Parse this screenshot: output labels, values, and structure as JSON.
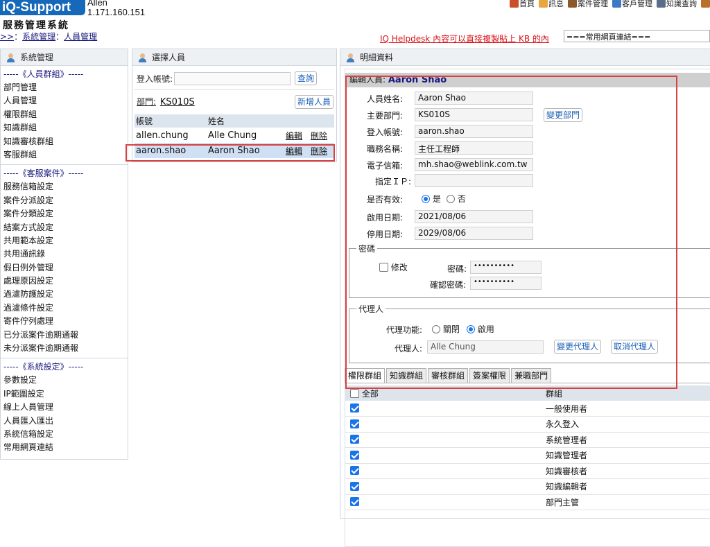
{
  "header": {
    "logo": "iQ-Support",
    "user_name": "Allen",
    "user_ip": "1.171.160.151",
    "system_name": "服務管理系統",
    "breadcrumb": {
      "prefix": ">>",
      "sep": "：",
      "level1": "系統管理",
      "level2": "人員管理"
    },
    "nav": [
      {
        "label": "首頁",
        "icon": "home-icon",
        "color": "#c94f2a"
      },
      {
        "label": "訊息",
        "icon": "mail-icon",
        "color": "#e8a640"
      },
      {
        "label": "案件管理",
        "icon": "case-icon",
        "color": "#8a5a2b"
      },
      {
        "label": "客戶管理",
        "icon": "customer-icon",
        "color": "#3d7ac4"
      },
      {
        "label": "知識查詢",
        "icon": "search-icon",
        "color": "#5a6e8a"
      },
      {
        "label": "",
        "icon": "logout-icon",
        "color": "#b8702a"
      }
    ],
    "helpdesk_text": "IQ Helpdesk 內容可以直接複製貼上 KB 的內",
    "links_select": "===常用網頁連結==="
  },
  "left_panel": {
    "title": "系統管理",
    "sections": [
      {
        "heading": "-----《人員群組》-----",
        "items": [
          "部門管理",
          "人員管理",
          "權限群組",
          "知識群組",
          "知識審核群組",
          "客服群組"
        ]
      },
      {
        "heading": "-----《客服案件》-----",
        "items": [
          "服務信箱設定",
          "案件分派設定",
          "案件分類設定",
          "結案方式設定",
          "共用範本設定",
          "共用通訊錄",
          "假日例外管理",
          "處理原因設定",
          "過濾防護設定",
          "過濾條件設定",
          "寄件佇列處理",
          "已分派案件逾期通報",
          "未分派案件逾期通報"
        ]
      },
      {
        "heading": "-----《系統設定》-----",
        "items": [
          "參數設定",
          "IP範圍設定",
          "線上人員管理",
          "人員匯入匯出",
          "系統信箱設定",
          "常用網頁連結"
        ]
      }
    ]
  },
  "middle_panel": {
    "title": "選擇人員",
    "login_label": "登入帳號:",
    "login_value": "",
    "query_button": "查詢",
    "dept_label": "部門:",
    "dept_value": "KS010S",
    "add_button": "新增人員",
    "columns": [
      "帳號",
      "姓名"
    ],
    "rows": [
      {
        "account": "allen.chung",
        "name": "Alle Chung",
        "edit": "編輯",
        "delete": "刪除"
      },
      {
        "account": "aaron.shao",
        "name": "Aaron Shao",
        "edit": "編輯",
        "delete": "刪除"
      }
    ]
  },
  "right_panel": {
    "title": "明細資料",
    "editing_label": "編輯人員:",
    "editing_name": "Aaron Shao",
    "fields": {
      "name_label": "人員姓名:",
      "name": "Aaron Shao",
      "dept_label": "主要部門:",
      "dept": "KS010S",
      "change_dept_button": "變更部門",
      "login_label": "登入帳號:",
      "login": "aaron.shao",
      "title_label": "職務名稱:",
      "title": "主任工程師",
      "email_label": "電子信箱:",
      "email": "mh.shao@weblink.com.tw",
      "ip_label": "指定ＩＰ:",
      "ip": "",
      "valid_label": "是否有效:",
      "valid_yes": "是",
      "valid_no": "否",
      "start_label": "啟用日期:",
      "start": "2021/08/06",
      "end_label": "停用日期:",
      "end": "2029/08/06"
    },
    "password": {
      "legend": "密碼",
      "modify_label": "修改",
      "pw_label": "密碼:",
      "pw": "••••••••••",
      "confirm_label": "確認密碼:",
      "confirm": "••••••••••"
    },
    "proxy": {
      "legend": "代理人",
      "function_label": "代理功能:",
      "off": "關閉",
      "on": "啟用",
      "agent_label": "代理人:",
      "agent": "Alle Chung",
      "change_button": "變更代理人",
      "cancel_button": "取消代理人"
    },
    "tabs": [
      "權限群組",
      "知識群組",
      "審核群組",
      "簽案權限",
      "兼職部門"
    ],
    "group_table": {
      "col_all": "全部",
      "col_group": "群組",
      "rows": [
        "一般使用者",
        "永久登入",
        "系統管理者",
        "知識管理者",
        "知識審核者",
        "知識編輯者",
        "部門主管"
      ]
    }
  }
}
